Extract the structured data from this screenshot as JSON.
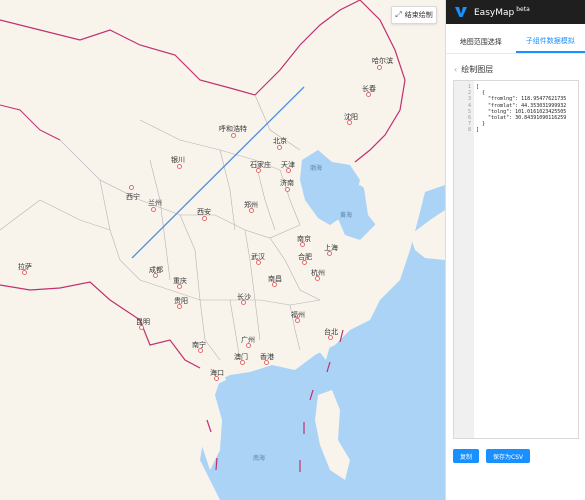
{
  "map": {
    "end_draw_label": "结束绘制",
    "cities": [
      {
        "name": "哈尔滨"
      },
      {
        "name": "长春"
      },
      {
        "name": "沈阳"
      },
      {
        "name": "呼和浩特"
      },
      {
        "name": "北京"
      },
      {
        "name": "天津"
      },
      {
        "name": "石家庄"
      },
      {
        "name": "银川"
      },
      {
        "name": "济南"
      },
      {
        "name": "西宁"
      },
      {
        "name": "兰州"
      },
      {
        "name": "西安"
      },
      {
        "name": "郑州"
      },
      {
        "name": "南京"
      },
      {
        "name": "上海"
      },
      {
        "name": "合肥"
      },
      {
        "name": "武汉"
      },
      {
        "name": "杭州"
      },
      {
        "name": "拉萨"
      },
      {
        "name": "成都"
      },
      {
        "name": "重庆"
      },
      {
        "name": "南昌"
      },
      {
        "name": "长沙"
      },
      {
        "name": "贵阳"
      },
      {
        "name": "福州"
      },
      {
        "name": "台北"
      },
      {
        "name": "昆明"
      },
      {
        "name": "南宁"
      },
      {
        "name": "广州"
      },
      {
        "name": "澳门"
      },
      {
        "name": "香港"
      },
      {
        "name": "海口"
      }
    ],
    "seas": [
      "渤海",
      "黄海",
      "南海"
    ]
  },
  "panel": {
    "brand": "EasyMap",
    "brand_badge": "beta",
    "tabs": [
      {
        "label": "地图范围选择"
      },
      {
        "label": "子组件数据模拟"
      }
    ],
    "section_title": "绘制图层",
    "code_lines": [
      "[",
      "  {",
      "    \"fromlng\": 118.95477621735",
      "    \"fromlat\": 44.353031999932",
      "    \"tolng\": 101.0161023425505",
      "    \"tolat\": 30.84391090116259",
      "  }",
      "]"
    ],
    "line_numbers": [
      "1",
      "2",
      "3",
      "4",
      "5",
      "6",
      "7",
      "8"
    ],
    "copy_label": "复制",
    "save_csv_label": "保存为CSV"
  },
  "colors": {
    "accent": "#1890ff",
    "topbar": "#1f1f1f",
    "land": "#f8f4ec",
    "water": "#aad3f5",
    "border": "#c03070"
  }
}
